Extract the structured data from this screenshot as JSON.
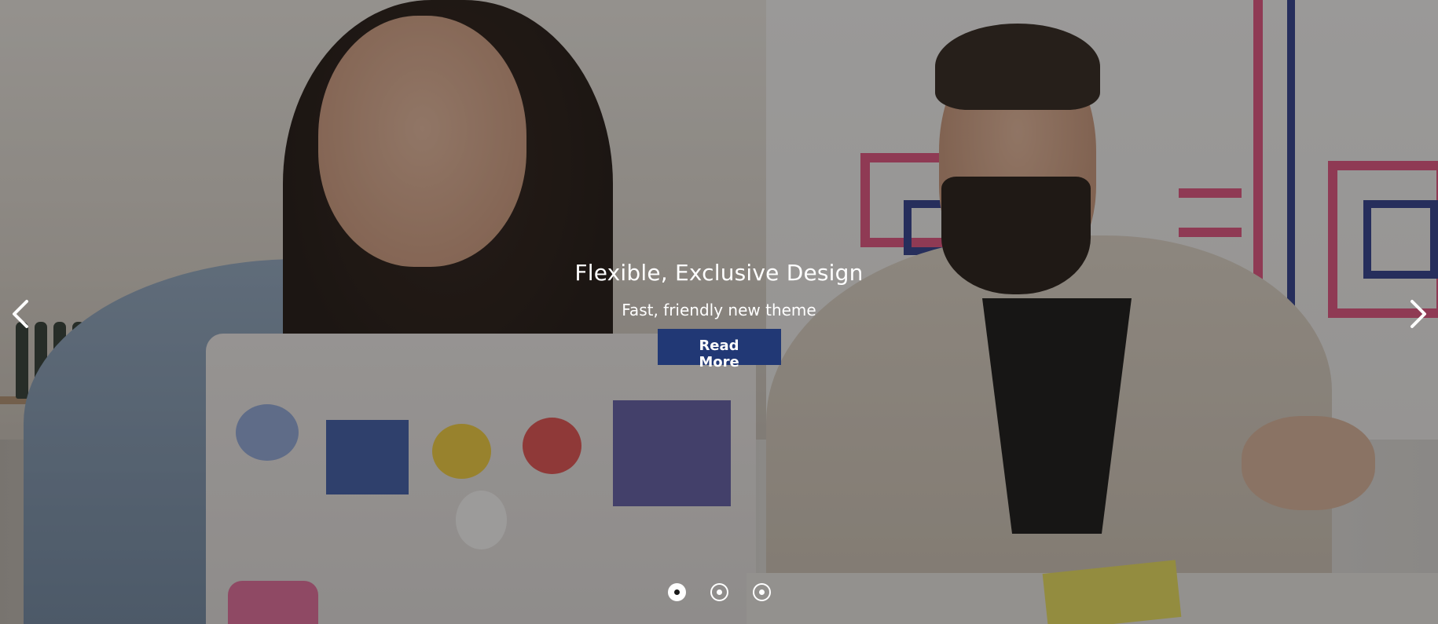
{
  "slider": {
    "slide_title": "Flexible, Exclusive Design",
    "slide_subtitle": "Fast, friendly new theme",
    "button_label": "Read More",
    "prev_icon": "chevron-left-icon",
    "next_icon": "chevron-right-icon",
    "slide_count": 3,
    "active_slide": 1,
    "colors": {
      "button_bg": "#213875",
      "text": "#ffffff",
      "overlay": "rgba(30,28,26,0.42)"
    }
  }
}
